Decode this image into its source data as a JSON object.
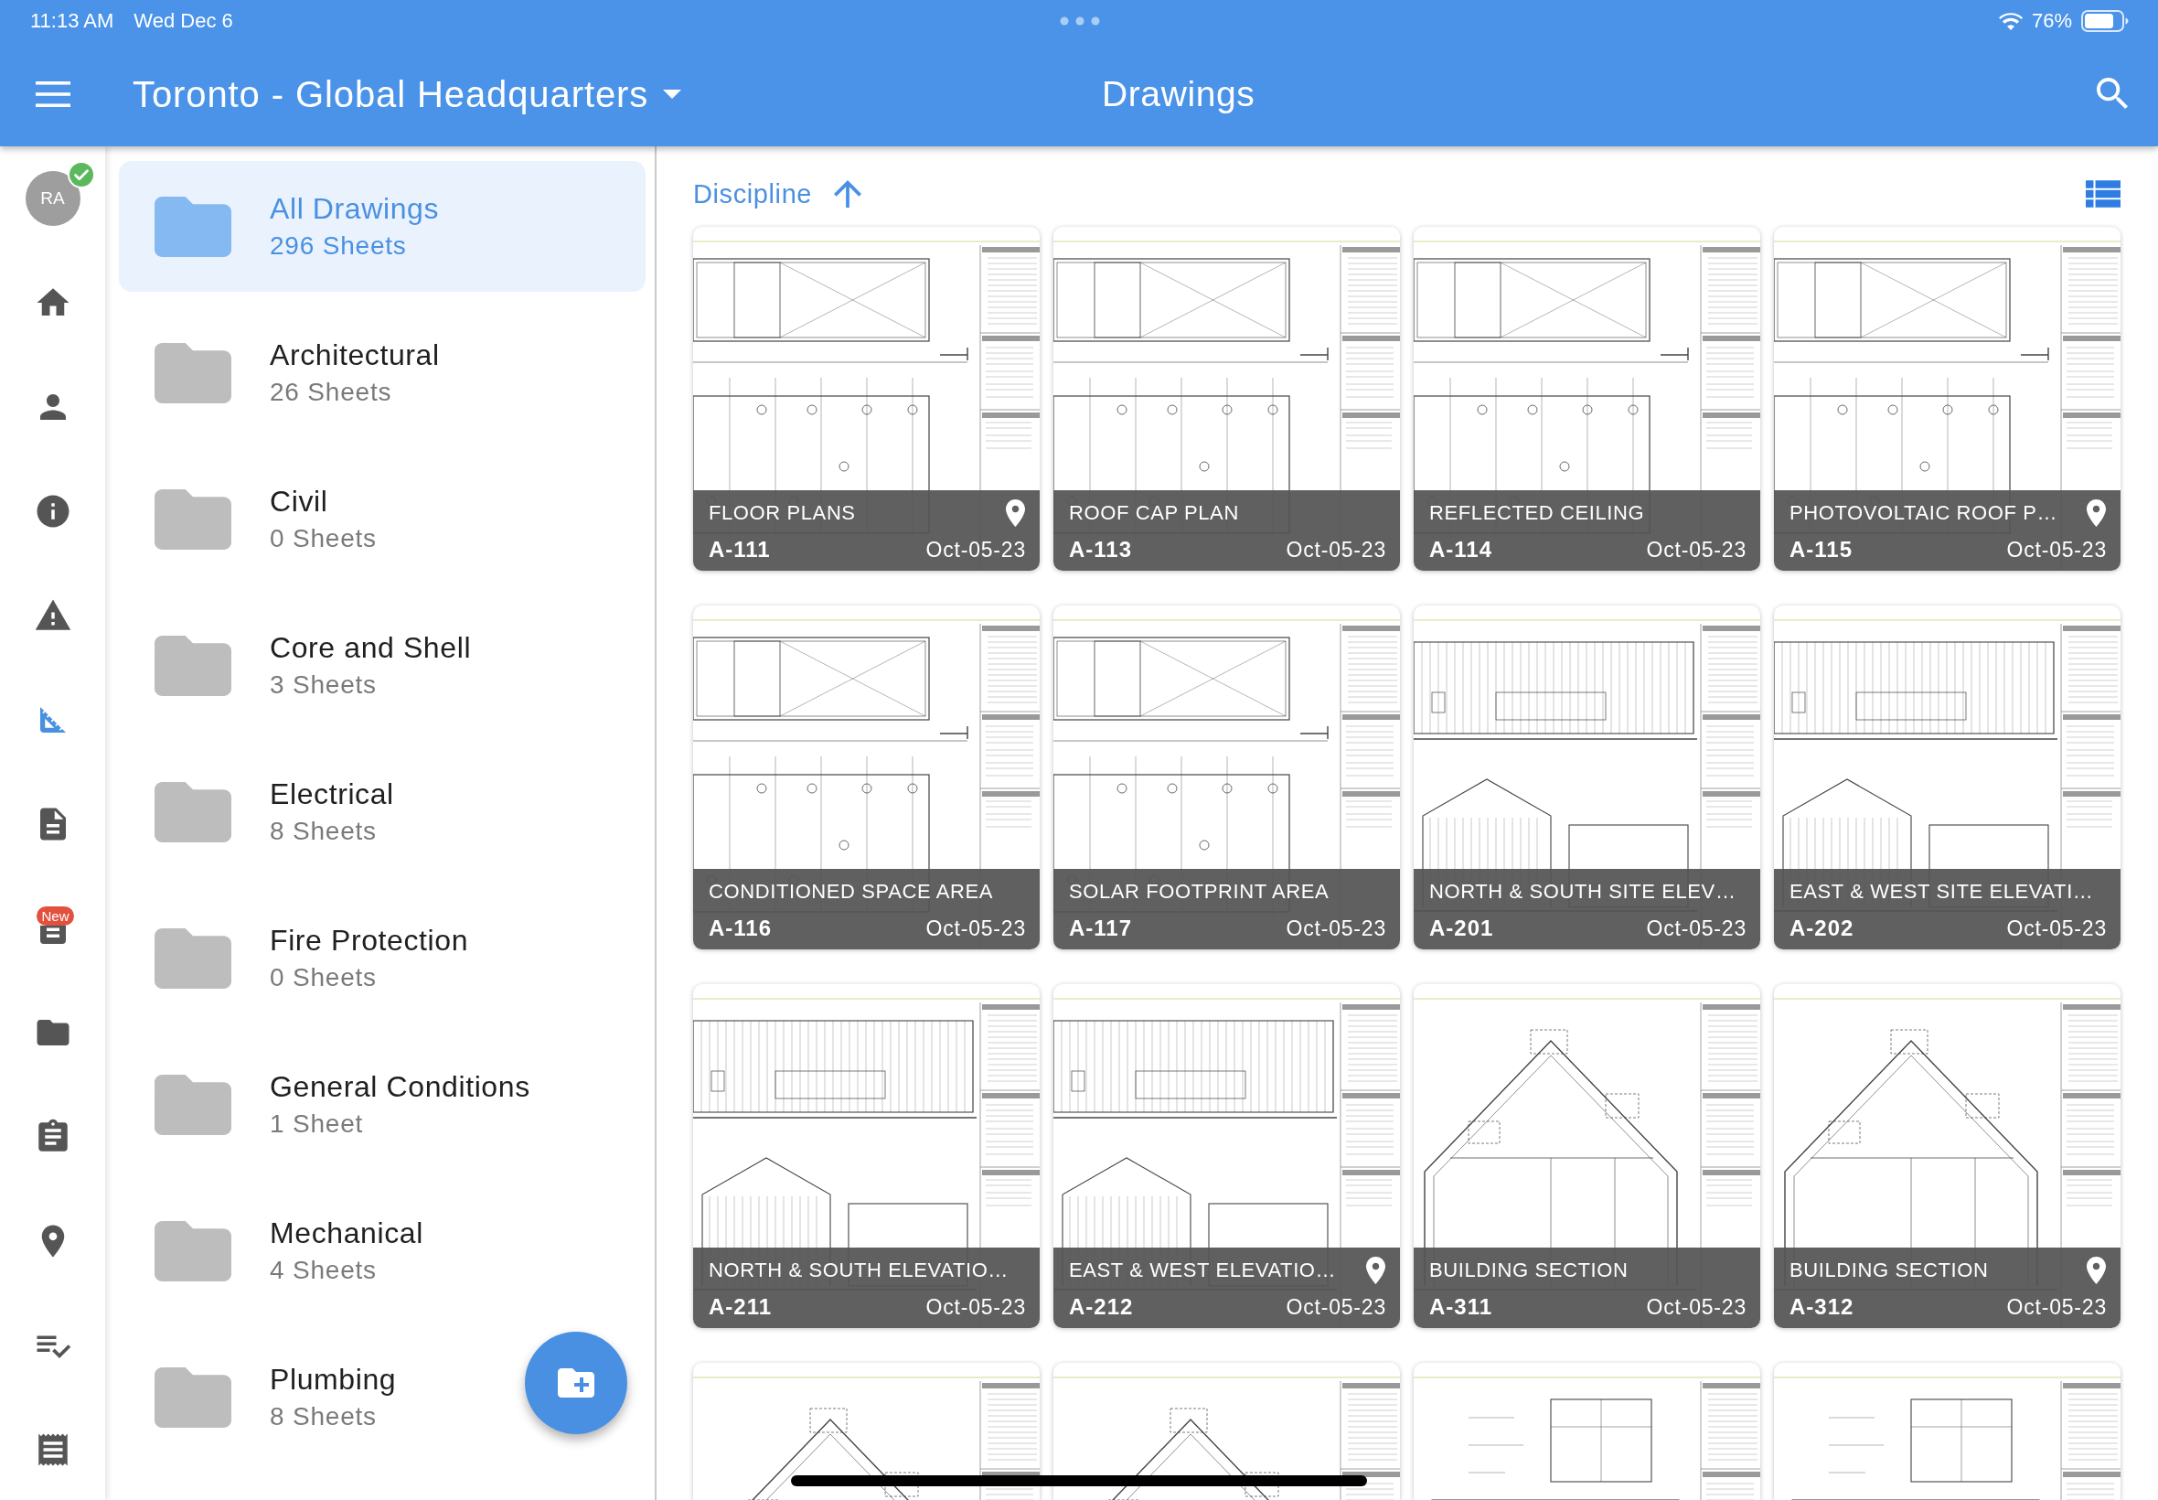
{
  "status_bar": {
    "time": "11:13 AM",
    "date": "Wed Dec 6",
    "battery": "76%"
  },
  "app_bar": {
    "project": "Toronto - Global Headquarters",
    "title": "Drawings"
  },
  "rail": {
    "avatar": {
      "initials": "RA",
      "verified": true
    },
    "items": [
      {
        "selected": false
      },
      {
        "selected": false
      },
      {
        "selected": false
      },
      {
        "selected": false
      },
      {
        "selected": true
      },
      {
        "selected": false
      },
      {
        "selected": false,
        "badge": "New"
      },
      {
        "selected": false
      },
      {
        "selected": false
      },
      {
        "selected": false
      },
      {
        "selected": false
      },
      {
        "selected": false
      }
    ]
  },
  "folders": [
    {
      "name": "All Drawings",
      "count": "296 Sheets",
      "selected": true
    },
    {
      "name": "Architectural",
      "count": "26 Sheets",
      "selected": false
    },
    {
      "name": "Civil",
      "count": "0 Sheets",
      "selected": false
    },
    {
      "name": "Core and Shell",
      "count": "3 Sheets",
      "selected": false
    },
    {
      "name": "Electrical",
      "count": "8 Sheets",
      "selected": false
    },
    {
      "name": "Fire Protection",
      "count": "0 Sheets",
      "selected": false
    },
    {
      "name": "General Conditions",
      "count": "1 Sheet",
      "selected": false
    },
    {
      "name": "Mechanical",
      "count": "4 Sheets",
      "selected": false
    },
    {
      "name": "Plumbing",
      "count": "8 Sheets",
      "selected": false
    }
  ],
  "sort": {
    "label": "Discipline",
    "ascending": true
  },
  "sheets": [
    {
      "title": "FLOOR PLANS",
      "code": "A-111",
      "date": "Oct-05-23",
      "pinned": true,
      "kind": "plan"
    },
    {
      "title": "ROOF CAP PLAN",
      "code": "A-113",
      "date": "Oct-05-23",
      "pinned": false,
      "kind": "plan"
    },
    {
      "title": "REFLECTED CEILING",
      "code": "A-114",
      "date": "Oct-05-23",
      "pinned": false,
      "kind": "plan"
    },
    {
      "title": "PHOTOVOLTAIC ROOF P…",
      "code": "A-115",
      "date": "Oct-05-23",
      "pinned": true,
      "kind": "plan"
    },
    {
      "title": "CONDITIONED SPACE AREA",
      "code": "A-116",
      "date": "Oct-05-23",
      "pinned": false,
      "kind": "plan"
    },
    {
      "title": "SOLAR FOOTPRINT AREA",
      "code": "A-117",
      "date": "Oct-05-23",
      "pinned": false,
      "kind": "plan"
    },
    {
      "title": "NORTH & SOUTH SITE ELEV…",
      "code": "A-201",
      "date": "Oct-05-23",
      "pinned": false,
      "kind": "elevation"
    },
    {
      "title": "EAST & WEST SITE ELEVATI…",
      "code": "A-202",
      "date": "Oct-05-23",
      "pinned": false,
      "kind": "elevation"
    },
    {
      "title": "NORTH & SOUTH ELEVATIO…",
      "code": "A-211",
      "date": "Oct-05-23",
      "pinned": false,
      "kind": "elevation"
    },
    {
      "title": "EAST & WEST ELEVATIO…",
      "code": "A-212",
      "date": "Oct-05-23",
      "pinned": true,
      "kind": "elevation"
    },
    {
      "title": "BUILDING SECTION",
      "code": "A-311",
      "date": "Oct-05-23",
      "pinned": false,
      "kind": "section"
    },
    {
      "title": "BUILDING SECTION",
      "code": "A-312",
      "date": "Oct-05-23",
      "pinned": true,
      "kind": "section"
    }
  ],
  "partial_sheets": [
    {
      "kind": "section"
    },
    {
      "kind": "section"
    },
    {
      "kind": "detail"
    },
    {
      "kind": "detail"
    }
  ]
}
